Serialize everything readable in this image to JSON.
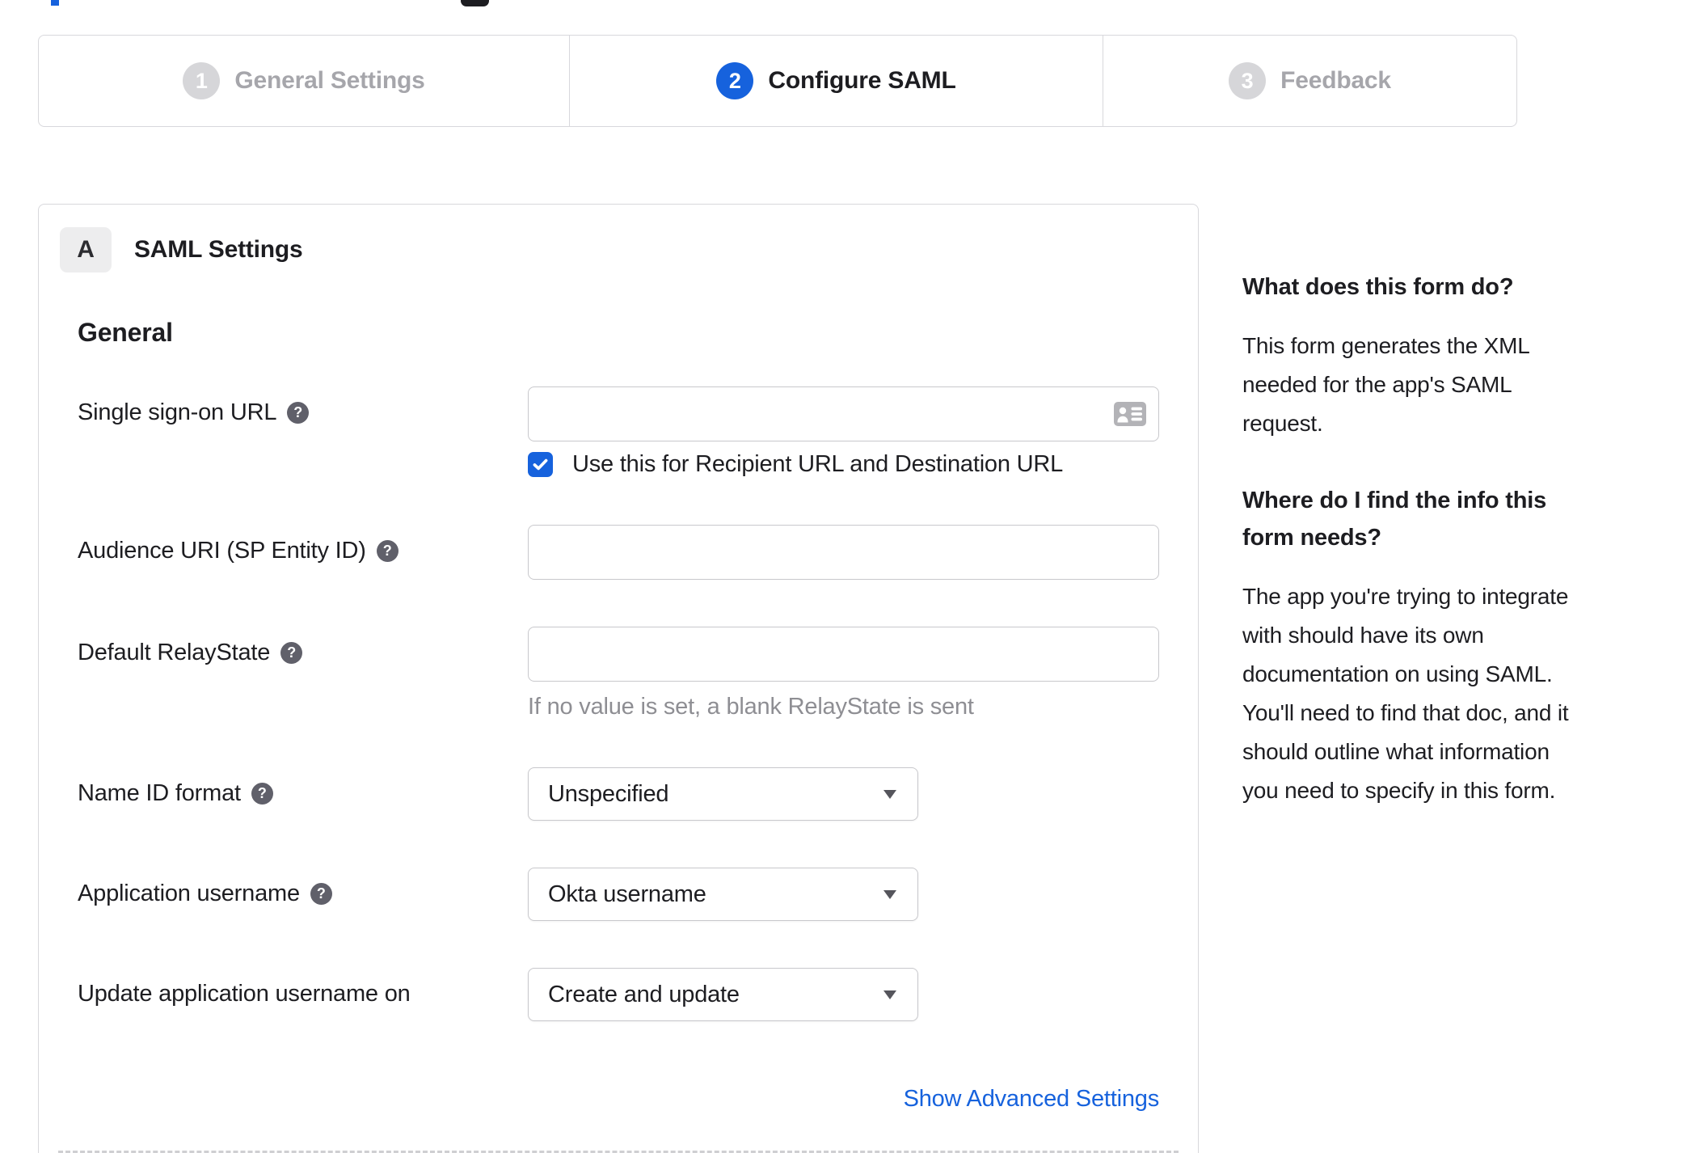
{
  "stepper": {
    "steps": [
      {
        "number": "1",
        "label": "General Settings",
        "state": "inactive"
      },
      {
        "number": "2",
        "label": "Configure SAML",
        "state": "active"
      },
      {
        "number": "3",
        "label": "Feedback",
        "state": "inactive"
      }
    ]
  },
  "saml_card": {
    "section_badge": "A",
    "section_title": "SAML Settings",
    "subsection_title": "General",
    "help_icon": "?",
    "fields": {
      "sso_url": {
        "label": "Single sign-on URL",
        "value": "",
        "checkbox_checked": true,
        "checkbox_label": "Use this for Recipient URL and Destination URL"
      },
      "audience_uri": {
        "label": "Audience URI (SP Entity ID)",
        "value": ""
      },
      "default_relay_state": {
        "label": "Default RelayState",
        "value": "",
        "hint": "If no value is set, a blank RelayState is sent"
      },
      "name_id_format": {
        "label": "Name ID format",
        "value": "Unspecified"
      },
      "application_username": {
        "label": "Application username",
        "value": "Okta username"
      },
      "update_app_username": {
        "label": "Update application username on",
        "value": "Create and update"
      }
    },
    "advanced_link": "Show Advanced Settings"
  },
  "help_panel": {
    "sections": [
      {
        "heading": "What does this form do?",
        "body": "This form generates the XML needed for the app's SAML request."
      },
      {
        "heading": "Where do I find the info this form needs?",
        "body": "The app you're trying to integrate with should have its own documentation on using SAML. You'll need to find that doc, and it should outline what information you need to specify in this form."
      }
    ]
  },
  "colors": {
    "accent_blue": "#1662dd",
    "link_blue": "#1662dd",
    "active_text": "#1d1d21",
    "inactive_text": "#a6a6ab",
    "inactive_circle": "#d6d6d9",
    "border_gray": "#d8d8dc",
    "hint_gray": "#8e8e93"
  }
}
